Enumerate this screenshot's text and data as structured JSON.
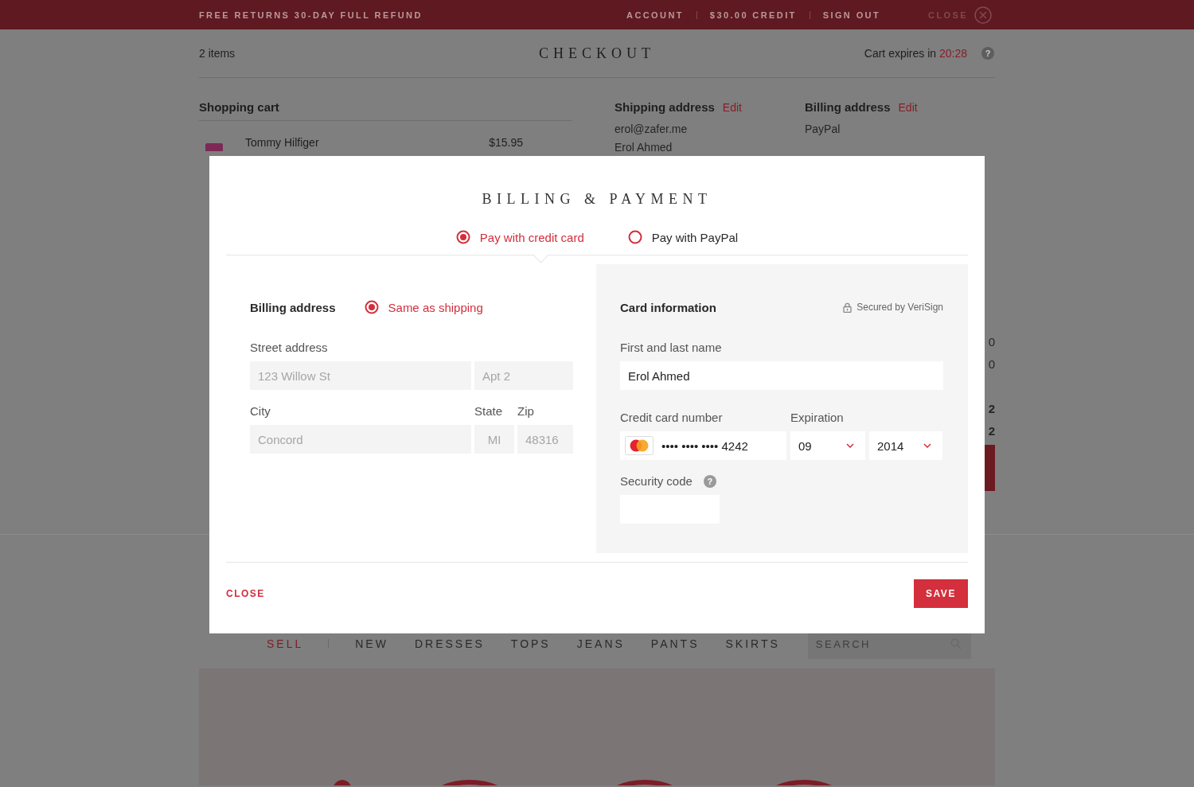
{
  "top_bar": {
    "promo": "FREE RETURNS 30-DAY FULL REFUND",
    "links": [
      "ACCOUNT",
      "$30.00 CREDIT",
      "SIGN OUT"
    ],
    "close": "CLOSE"
  },
  "header": {
    "count": "2 items",
    "title": "CHECKOUT",
    "expires_label": "Cart expires in",
    "expires_time": "20:28",
    "help": "?"
  },
  "cart": {
    "title": "Shopping cart",
    "items": [
      {
        "name": "Tommy Hilfiger",
        "price": "$15.95"
      }
    ]
  },
  "addresses": [
    {
      "title": "Shipping address",
      "edit": "Edit",
      "lines": [
        "erol@zafer.me",
        "Erol Ahmed"
      ]
    },
    {
      "title": "Billing address",
      "edit": "Edit",
      "lines": [
        "PayPal"
      ]
    }
  ],
  "summary_fragments": [
    "0",
    "0",
    "2",
    "2"
  ],
  "nav": {
    "items": [
      {
        "label": "SELL",
        "kind": "accent"
      },
      {
        "label": "NEW",
        "kind": "plain"
      },
      {
        "label": "DRESSES",
        "kind": "plain"
      },
      {
        "label": "TOPS",
        "kind": "plain"
      },
      {
        "label": "JEANS",
        "kind": "plain"
      },
      {
        "label": "PANTS",
        "kind": "plain"
      },
      {
        "label": "SKIRTS",
        "kind": "plain"
      }
    ],
    "search_placeholder": "SEARCH"
  },
  "modal": {
    "title": "BILLING & PAYMENT",
    "methods": [
      {
        "label": "Pay with credit card",
        "selected": true
      },
      {
        "label": "Pay with PayPal",
        "selected": false
      }
    ],
    "billing": {
      "title": "Billing address",
      "same_as_shipping": {
        "label": "Same as shipping",
        "selected": true
      },
      "rows": [
        [
          {
            "label": "Street address",
            "value": "123 Willow St",
            "disabled": true
          },
          {
            "value": "Apt 2",
            "disabled": true
          }
        ],
        [
          {
            "label": "City",
            "value": "Concord",
            "disabled": true
          },
          {
            "label": "State",
            "value": "MI",
            "disabled": true
          },
          {
            "label": "Zip",
            "value": "48316",
            "disabled": true
          }
        ]
      ]
    },
    "card": {
      "title": "Card information",
      "secure_note": "Secured by VeriSign",
      "name": {
        "label": "First and last name",
        "value": "Erol Ahmed"
      },
      "number": {
        "label": "Credit card number",
        "value": "•••• •••• •••• 4242"
      },
      "expiration": {
        "label": "Expiration",
        "month": "09",
        "year": "2014"
      },
      "security": {
        "label": "Security code",
        "help": "?"
      }
    },
    "close": "CLOSE",
    "save": "SAVE"
  }
}
